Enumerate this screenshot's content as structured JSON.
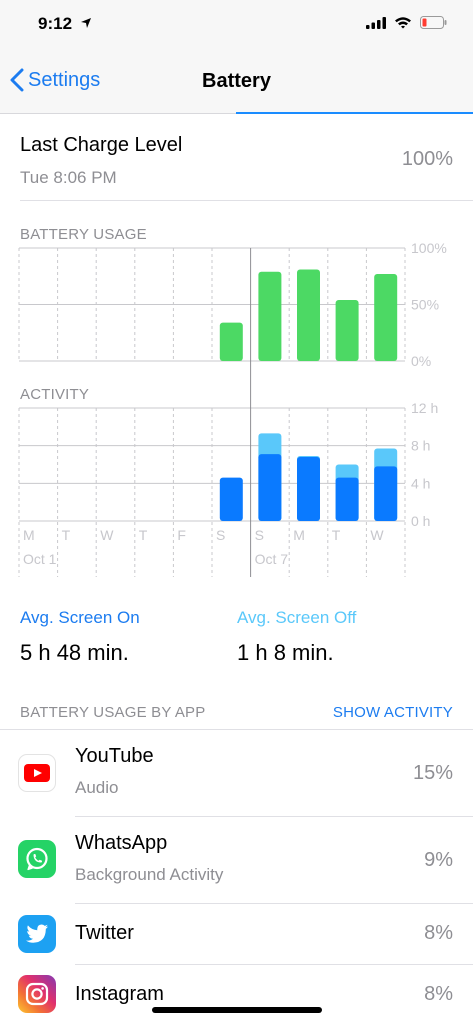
{
  "status": {
    "time": "9:12"
  },
  "nav": {
    "back_label": "Settings",
    "title": "Battery"
  },
  "last_charge": {
    "label": "Last Charge Level",
    "time": "Tue 8:06 PM",
    "value": "100%"
  },
  "usage_chart": {
    "label": "BATTERY USAGE",
    "y_ticks": [
      "100%",
      "50%",
      "0%"
    ]
  },
  "activity_chart": {
    "label": "ACTIVITY",
    "y_ticks": [
      "12 h",
      "8 h",
      "4 h",
      "0 h"
    ],
    "day_labels": [
      "M",
      "T",
      "W",
      "T",
      "F",
      "S",
      "S",
      "M",
      "T",
      "W"
    ],
    "date_labels": [
      "Oct 1",
      "Oct 7"
    ]
  },
  "chart_data": [
    {
      "type": "bar",
      "title": "BATTERY USAGE",
      "categories": [
        "M",
        "T",
        "W",
        "T",
        "F",
        "S",
        "S",
        "M",
        "T",
        "W"
      ],
      "values": [
        0,
        0,
        0,
        0,
        0,
        34,
        79,
        81,
        54,
        77
      ],
      "ylim": [
        0,
        100
      ],
      "y_unit": "%",
      "color": "#4cd964"
    },
    {
      "type": "bar",
      "title": "ACTIVITY",
      "categories": [
        "M",
        "T",
        "W",
        "T",
        "F",
        "S",
        "S",
        "M",
        "T",
        "W"
      ],
      "series": [
        {
          "name": "Screen On",
          "values": [
            0,
            0,
            0,
            0,
            0,
            4.6,
            7.1,
            6.8,
            4.6,
            5.8
          ],
          "color": "#0a7aff"
        },
        {
          "name": "Screen Off",
          "values": [
            0,
            0,
            0,
            0,
            0,
            0,
            2.2,
            0.1,
            1.4,
            1.9
          ],
          "color": "#5ac8fa"
        }
      ],
      "stacked": true,
      "ylim": [
        0,
        12
      ],
      "y_unit": "h"
    }
  ],
  "averages": {
    "screen_on": {
      "label": "Avg. Screen On",
      "value": "5 h 48 min."
    },
    "screen_off": {
      "label": "Avg. Screen Off",
      "value": "1 h 8 min."
    }
  },
  "apps_header": {
    "label": "BATTERY USAGE BY APP",
    "action": "SHOW ACTIVITY"
  },
  "apps": [
    {
      "name": "YouTube",
      "detail": "Audio",
      "percent": "15%",
      "icon": "youtube-icon"
    },
    {
      "name": "WhatsApp",
      "detail": "Background Activity",
      "percent": "9%",
      "icon": "whatsapp-icon"
    },
    {
      "name": "Twitter",
      "detail": "",
      "percent": "8%",
      "icon": "twitter-icon"
    },
    {
      "name": "Instagram",
      "detail": "",
      "percent": "8%",
      "icon": "instagram-icon"
    }
  ],
  "colors": {
    "accent": "#1c7cf0",
    "usage_bar": "#4cd964",
    "screen_on": "#0a7aff",
    "screen_off": "#5ac8fa"
  }
}
